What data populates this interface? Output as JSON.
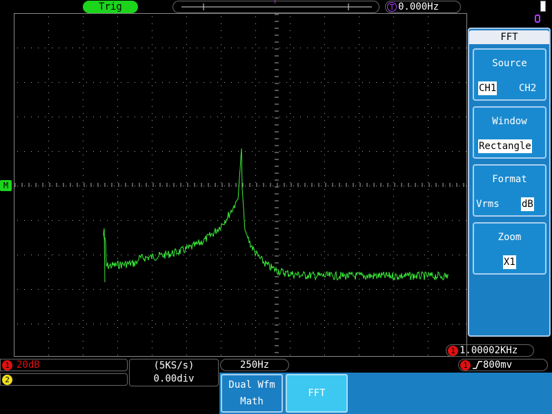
{
  "top": {
    "trig_label": "Trig",
    "trigger_marker": "T",
    "trig_freq_icon": "T",
    "trig_freq": "0.000Hz"
  },
  "markers": {
    "math_marker": "M"
  },
  "fft_menu": {
    "title": "FFT",
    "source": {
      "label": "Source",
      "options": [
        "CH1",
        "CH2"
      ],
      "selected": "CH1"
    },
    "window": {
      "label": "Window",
      "value": "Rectangle"
    },
    "format": {
      "label": "Format",
      "options": [
        "Vrms",
        "dB"
      ],
      "selected": "dB"
    },
    "zoom": {
      "label": "Zoom",
      "value": "X1"
    }
  },
  "status": {
    "ch1_number": "1",
    "ch1_scale": "20dB",
    "ch2_number": "2",
    "sample_rate": "(5KS/s)",
    "h_offset": "0.00div",
    "freq_div": "250Hz",
    "freq_counter": "1.00002KHz",
    "counter_channel": "1",
    "trig_channel": "1",
    "trig_level": "800mv"
  },
  "softkeys": {
    "dual_wfm_math_line1": "Dual Wfm",
    "dual_wfm_math_line2": "Math",
    "fft": "FFT"
  },
  "colors": {
    "trace": "#3cf03c",
    "ch1": "#e01010",
    "ch2": "#f0e020",
    "menu_bg": "#1b7fc4",
    "trig_badge": "#1cd41c"
  }
}
